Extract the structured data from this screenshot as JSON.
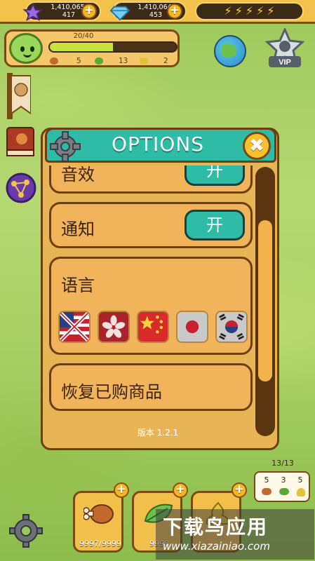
{
  "currency": {
    "stars": "1,410,065,\n417",
    "stars_line1": "1,410,065,",
    "stars_line2": "417",
    "gems_line1": "1,410,064,",
    "gems_line2": "453"
  },
  "energy": {
    "bolts": 5
  },
  "pet": {
    "hp_text": "20/40",
    "hp_fraction": 0.5,
    "stat_food": "5",
    "stat_leaf": "13",
    "stat_poop": "2"
  },
  "badges": {
    "vip_label": "VIP"
  },
  "dialog": {
    "title": "OPTIONS",
    "rows": {
      "sound_label": "音效",
      "sound_toggle": "开",
      "notify_label": "通知",
      "notify_toggle": "开",
      "language_label": "语言",
      "restore_label": "恢复已购商品"
    },
    "languages": [
      "english-flag",
      "hongkong-flag",
      "china-flag",
      "japan-flag",
      "korea-flag"
    ],
    "version": "版本 1.2.1"
  },
  "bubble": {
    "count": "13/13",
    "food": "5",
    "leaf": "3",
    "poop": "5"
  },
  "food_slots": {
    "meat_count": "9997/9999",
    "leaf_count": "9998"
  },
  "watermark": {
    "title": "下载鸟应用",
    "url": "www.xiazainiao.com"
  },
  "colors": {
    "teal": "#2ebca6",
    "panel": "#f1b45a",
    "border": "#6d3e0e",
    "gold": "#f3c24a"
  }
}
